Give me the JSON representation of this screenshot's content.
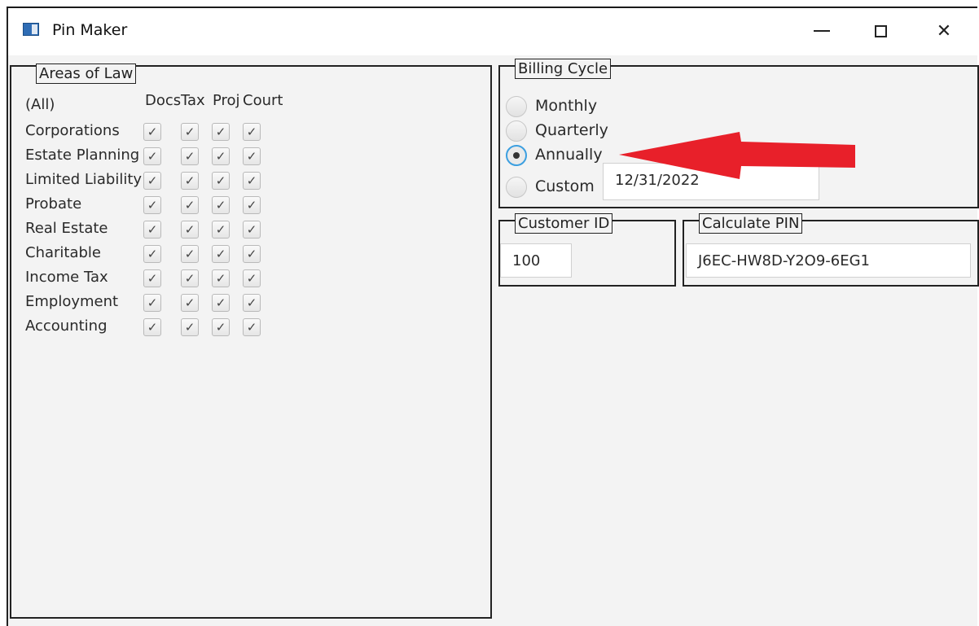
{
  "window": {
    "title": "Pin Maker"
  },
  "areas": {
    "legend": "Areas of Law",
    "all_label": "(All)",
    "columns": [
      "Docs",
      "Tax",
      "Proj",
      "Court"
    ],
    "rows": [
      {
        "label": "Corporations",
        "checks": [
          true,
          true,
          true,
          true
        ]
      },
      {
        "label": "Estate Planning",
        "checks": [
          true,
          true,
          true,
          true
        ]
      },
      {
        "label": "Limited Liability",
        "checks": [
          true,
          true,
          true,
          true
        ]
      },
      {
        "label": "Probate",
        "checks": [
          true,
          true,
          true,
          true
        ]
      },
      {
        "label": "Real Estate",
        "checks": [
          true,
          true,
          true,
          true
        ]
      },
      {
        "label": "Charitable",
        "checks": [
          true,
          true,
          true,
          true
        ]
      },
      {
        "label": "Income Tax",
        "checks": [
          true,
          true,
          true,
          true
        ]
      },
      {
        "label": "Employment",
        "checks": [
          true,
          true,
          true,
          true
        ]
      },
      {
        "label": "Accounting",
        "checks": [
          true,
          true,
          true,
          true
        ]
      }
    ]
  },
  "billing": {
    "legend": "Billing Cycle",
    "options": [
      {
        "label": "Monthly",
        "selected": false
      },
      {
        "label": "Quarterly",
        "selected": false
      },
      {
        "label": "Annually",
        "selected": true
      },
      {
        "label": "Custom",
        "selected": false
      }
    ],
    "custom_date": "12/31/2022"
  },
  "customer": {
    "legend": "Customer ID",
    "value": "100"
  },
  "calculate": {
    "legend": "Calculate PIN",
    "value": "J6EC-HW8D-Y2O9-6EG1"
  },
  "colors": {
    "annotation_arrow": "#e8202a",
    "radio_focus": "#3c9fe0"
  }
}
